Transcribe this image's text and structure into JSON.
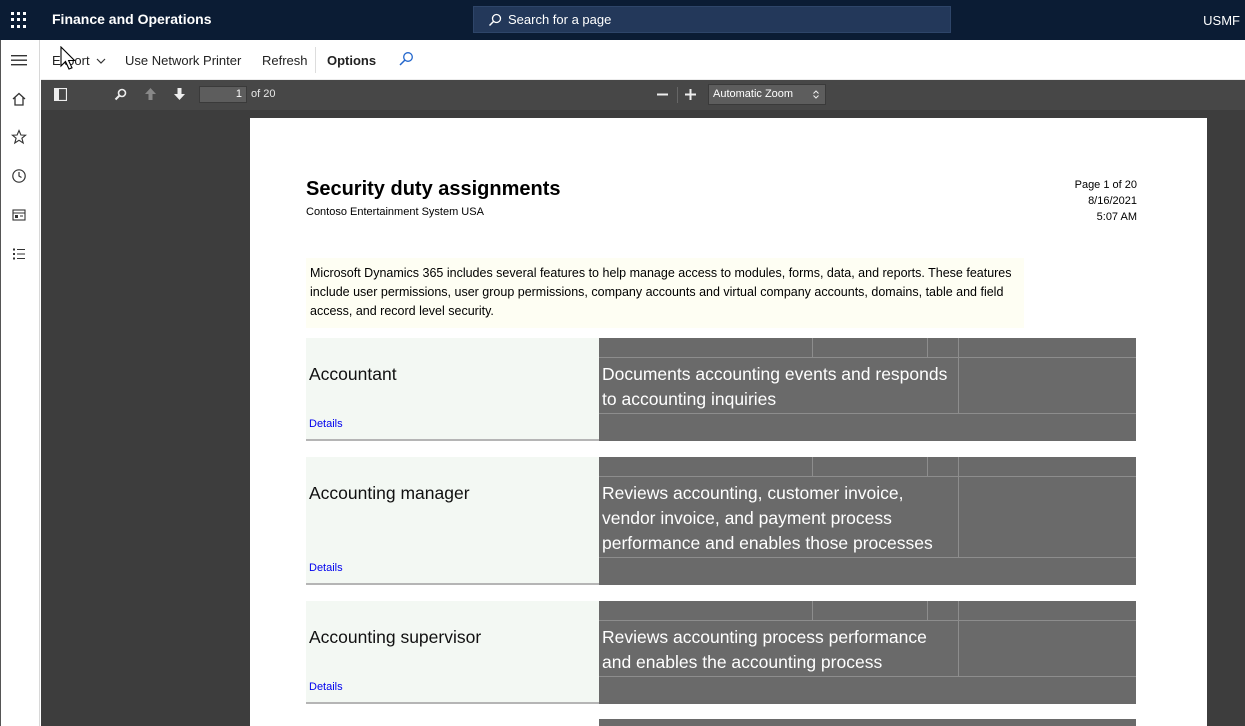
{
  "topbar": {
    "app_title": "Finance and Operations",
    "search_placeholder": "Search for a page",
    "company": "USMF"
  },
  "action_pane": {
    "export": "Export",
    "network_printer": "Use Network Printer",
    "refresh": "Refresh",
    "options": "Options"
  },
  "pdf_toolbar": {
    "page_current": "1",
    "page_total": "of 20",
    "zoom": "Automatic Zoom"
  },
  "report": {
    "title": "Security duty assignments",
    "subtitle": "Contoso Entertainment System USA",
    "page_label": "Page 1 of 20",
    "date": "8/16/2021",
    "time": "5:07 AM",
    "intro": "Microsoft Dynamics 365 includes several features to help manage access to modules, forms, data, and reports. These features include user permissions, user group permissions, company accounts and virtual company accounts, domains, table and field access, and record level security.",
    "roles": [
      {
        "name": "Accountant",
        "description": "Documents accounting events and responds to accounting inquiries",
        "link": "Details"
      },
      {
        "name": "Accounting manager",
        "description": "Reviews accounting, customer invoice, vendor invoice, and payment process performance and enables those processes",
        "link": "Details"
      },
      {
        "name": "Accounting supervisor",
        "description": "Reviews accounting process performance and enables the accounting process",
        "link": "Details"
      }
    ]
  }
}
